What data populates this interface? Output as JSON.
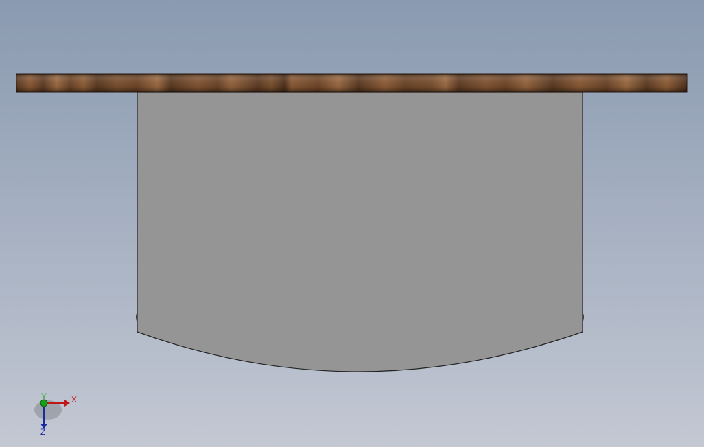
{
  "viewport": {
    "background_top": "#8a9ab0",
    "background_bottom": "#c3c8d3"
  },
  "model": {
    "flange_colors": [
      "#5a3a22",
      "#8a5a36",
      "#6e4528",
      "#9a6a42",
      "#4e311c"
    ],
    "body_color": "#959595",
    "edge_color": "#222222"
  },
  "triad": {
    "x_label": "X",
    "y_label": "Y",
    "z_label": "Z",
    "x_color": "#c01818",
    "y_color": "#18a018",
    "z_color": "#1a2aa0"
  }
}
